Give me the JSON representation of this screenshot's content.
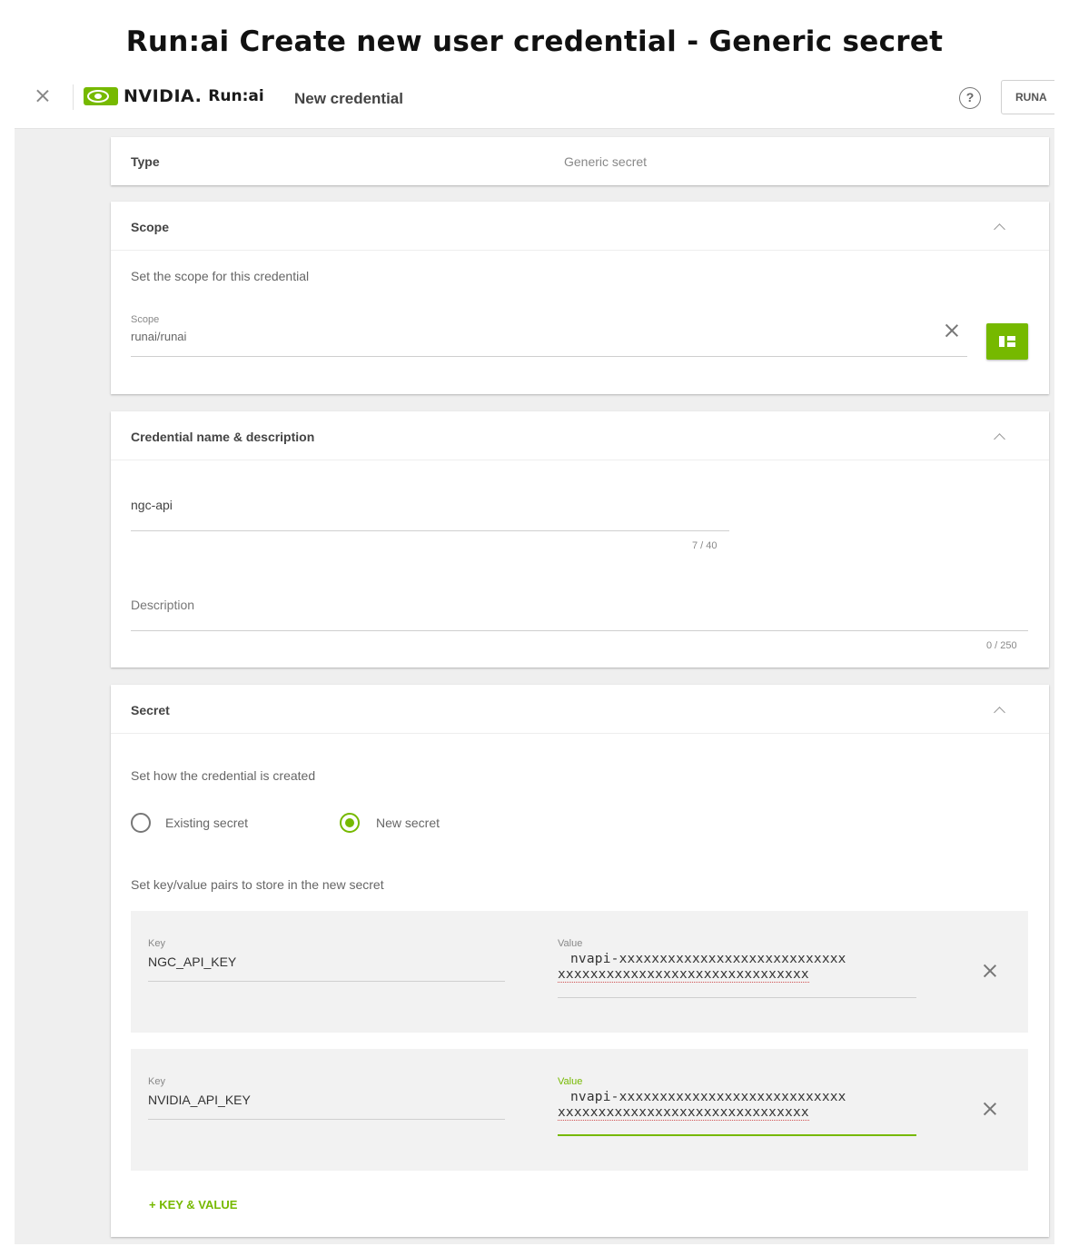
{
  "page_heading": "Run:ai Create new user credential - Generic secret",
  "topbar": {
    "brand_nvidia": "NVIDIA.",
    "brand_runai": "Run:ai",
    "title": "New credential",
    "help_glyph": "?",
    "org_badge": "RUNA"
  },
  "type_card": {
    "label": "Type",
    "value": "Generic secret"
  },
  "scope_card": {
    "title": "Scope",
    "description": "Set the scope for this credential",
    "field_label": "Scope",
    "field_value": "runai/runai"
  },
  "name_card": {
    "title": "Credential name & description",
    "name_value": "ngc-api",
    "name_counter": "7 / 40",
    "description_placeholder": "Description",
    "description_counter": "0 / 250"
  },
  "secret_card": {
    "title": "Secret",
    "description": "Set how the credential is created",
    "options": [
      {
        "label": "Existing secret",
        "selected": false
      },
      {
        "label": "New secret",
        "selected": true
      }
    ],
    "kv_instructions": "Set key/value pairs to store in the new secret",
    "key_label": "Key",
    "value_label": "Value",
    "pairs": [
      {
        "key": "NGC_API_KEY",
        "value_line1": "nvapi-xxxxxxxxxxxxxxxxxxxxxxxxxxxx",
        "value_line2": "xxxxxxxxxxxxxxxxxxxxxxxxxxxxxxx"
      },
      {
        "key": "NVIDIA_API_KEY",
        "value_line1": "nvapi-xxxxxxxxxxxxxxxxxxxxxxxxxxxx",
        "value_line2": "xxxxxxxxxxxxxxxxxxxxxxxxxxxxxxx"
      }
    ],
    "add_pair_label": "+ KEY & VALUE"
  },
  "colors": {
    "accent": "#76b900",
    "page_bg": "#efefef",
    "card_bg": "#ffffff",
    "field_box_bg": "#f2f2f2"
  }
}
